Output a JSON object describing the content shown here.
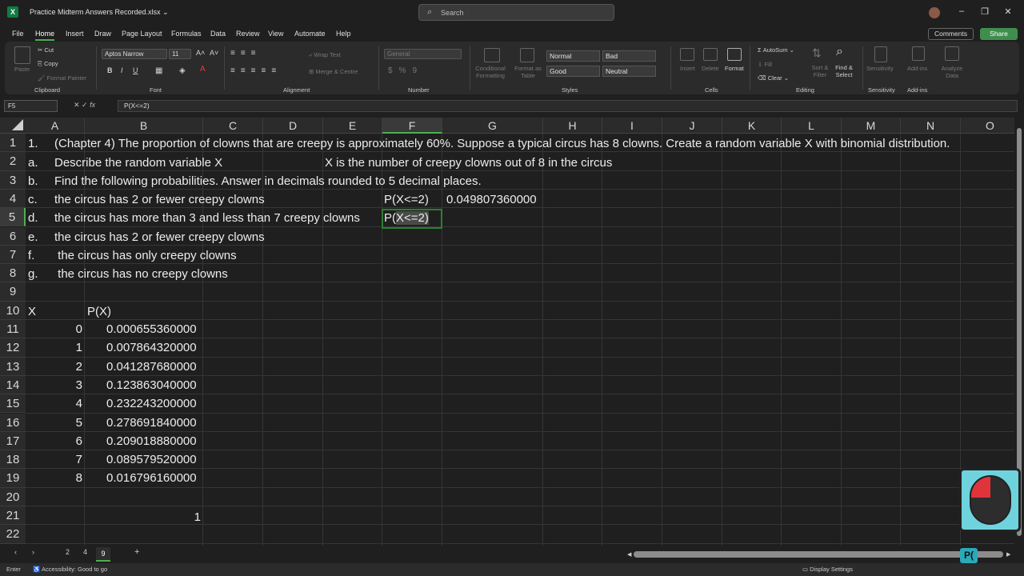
{
  "title_bar": {
    "app_icon": "X",
    "doc_title": "Practice Midterm Answers Recorded.xlsx ⌄",
    "search_placeholder": "Search"
  },
  "menu": [
    "File",
    "Home",
    "Insert",
    "Draw",
    "Page Layout",
    "Formulas",
    "Data",
    "Review",
    "View",
    "Automate",
    "Help"
  ],
  "actions": {
    "comments": "Comments",
    "share": "Share"
  },
  "ribbon": {
    "clipboard": {
      "paste": "Paste",
      "cut": "Cut",
      "copy": "Copy",
      "format_painter": "Format Painter",
      "group": "Clipboard"
    },
    "font": {
      "name": "Aptos Narrow",
      "size": "11",
      "group": "Font"
    },
    "alignment": {
      "wrap": "Wrap Text",
      "merge": "Merge & Centre",
      "group": "Alignment"
    },
    "number": {
      "format": "General",
      "group": "Number"
    },
    "styles": {
      "conditional": "Conditional Formatting",
      "format_as_table": "Format as Table",
      "normal": "Normal",
      "bad": "Bad",
      "good": "Good",
      "neutral": "Neutral",
      "group": "Styles"
    },
    "cells": {
      "insert": "Insert",
      "delete": "Delete",
      "format": "Format",
      "group": "Cells"
    },
    "editing": {
      "autosum": "AutoSum",
      "fill": "Fill",
      "clear": "Clear",
      "sort": "Sort & Filter",
      "find": "Find & Select",
      "group": "Editing"
    },
    "sensitivity": {
      "label": "Sensitivity",
      "group": "Sensitivity"
    },
    "addins": {
      "label": "Add-ins",
      "group": "Add-ins",
      "analyze": "Analyze Data"
    }
  },
  "formula_bar": {
    "name_box": "F5",
    "formula": "P(X<=2)"
  },
  "columns": [
    "A",
    "B",
    "C",
    "D",
    "E",
    "F",
    "G",
    "H",
    "I",
    "J",
    "K",
    "L",
    "M",
    "N",
    "O"
  ],
  "rows": [
    "1",
    "2",
    "3",
    "4",
    "5",
    "6",
    "7",
    "8",
    "9",
    "10",
    "11",
    "12",
    "13",
    "14",
    "15",
    "16",
    "17",
    "18",
    "19",
    "20",
    "21",
    "22"
  ],
  "cells": {
    "A1": "1.",
    "B1": "(Chapter 4) The proportion of clowns that are creepy is approximately 60%. Suppose a typical circus has 8 clowns. Create a random variable X with binomial distribution.",
    "A2": "a.",
    "B2": "Describe the random variable X",
    "E2": "X is the number of creepy clowns out of 8 in the circus",
    "A3": "b.",
    "B3": "Find the following probabilities. Answer in decimals rounded to 5 decimal places.",
    "A4": "c.",
    "B4": "the circus has 2 or fewer creepy clowns",
    "F4": "P(X<=2)",
    "G4": "0.049807360000",
    "A5": "d.",
    "B5": "the circus has more than 3 and less than 7 creepy clowns",
    "F5_pre": "P(",
    "F5_sel": "X<=2)",
    "A6": "e.",
    "B6": "the circus has 2 or fewer creepy clowns",
    "A7": "f.",
    "B7": " the circus has only creepy clowns",
    "A8": "g.",
    "B8": " the circus has no creepy clowns",
    "A10": "X",
    "B10": "P(X)",
    "A21": "",
    "B21": "1"
  },
  "table": [
    {
      "x": "0",
      "p": "0.000655360000"
    },
    {
      "x": "1",
      "p": "0.007864320000"
    },
    {
      "x": "2",
      "p": "0.041287680000"
    },
    {
      "x": "3",
      "p": "0.123863040000"
    },
    {
      "x": "4",
      "p": "0.232243200000"
    },
    {
      "x": "5",
      "p": "0.278691840000"
    },
    {
      "x": "6",
      "p": "0.209018880000"
    },
    {
      "x": "7",
      "p": "0.089579520000"
    },
    {
      "x": "8",
      "p": "0.016796160000"
    }
  ],
  "sheets": [
    "2",
    "4",
    "9"
  ],
  "status": {
    "mode": "Enter",
    "accessibility": "Accessibility: Good to go",
    "display": "Display Settings"
  },
  "overlay_text": "P("
}
